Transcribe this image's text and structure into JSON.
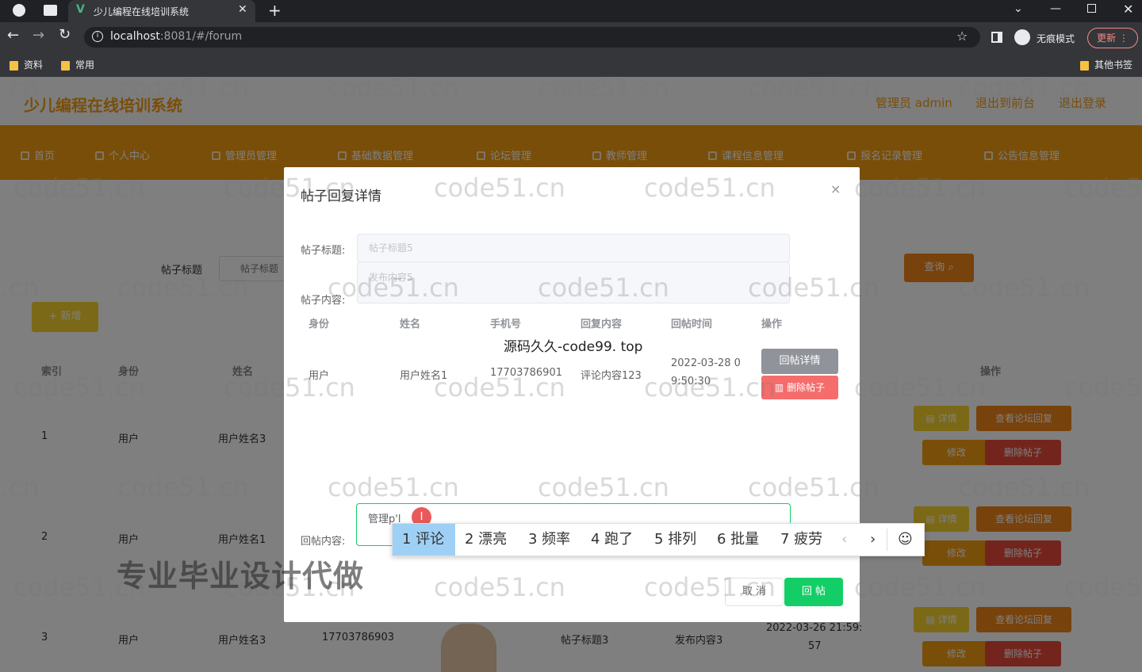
{
  "browser": {
    "tab_title": "少儿编程在线培训系统",
    "url_host": "localhost",
    "url_rest": ":8081/#/forum",
    "incognito_label": "无痕模式",
    "update_label": "更新",
    "bookmarks": [
      "资料",
      "常用"
    ],
    "other_bookmarks": "其他书签"
  },
  "header": {
    "site_title": "少儿编程在线培训系统",
    "admin_label": "管理员 admin",
    "to_front": "退出到前台",
    "logout": "退出登录"
  },
  "nav": [
    {
      "label": "首页"
    },
    {
      "label": "个人中心"
    },
    {
      "label": "管理员管理"
    },
    {
      "label": "基础数据管理"
    },
    {
      "label": "论坛管理"
    },
    {
      "label": "教师管理"
    },
    {
      "label": "课程信息管理"
    },
    {
      "label": "报名记录管理"
    },
    {
      "label": "公告信息管理"
    }
  ],
  "search": {
    "label": "帖子标题",
    "placeholder": "帖子标题",
    "query_button": "查询",
    "add_button": "+ 新增"
  },
  "table": {
    "headers": {
      "index": "索引",
      "role": "身份",
      "name": "姓名",
      "ops": "操作"
    },
    "rows": [
      {
        "index": "1",
        "role": "用户",
        "name": "用户姓名3"
      },
      {
        "index": "2",
        "role": "用户",
        "name": "用户姓名1"
      },
      {
        "index": "3",
        "role": "用户",
        "name": "用户姓名3",
        "phone": "17703786903",
        "title": "帖子标题3",
        "content": "发布内容3",
        "time": "2022-03-26 21:59:",
        "time2": "57"
      }
    ],
    "row_buttons": {
      "detail": "详情",
      "view_reply": "查看论坛回复",
      "edit": "修改",
      "delete": "删除帖子"
    }
  },
  "dialog": {
    "title": "帖子回复详情",
    "post_title_label": "帖子标题:",
    "post_title_value": "帖子标题5",
    "post_content_label": "帖子内容:",
    "post_content_value": "发布内容5",
    "columns": [
      "身份",
      "姓名",
      "手机号",
      "回复内容",
      "回帖时间",
      "操作"
    ],
    "reply_row": {
      "role": "用户",
      "name": "用户姓名1",
      "phone": "17703786901",
      "content": "评论内容123",
      "time_line1": "2022-03-28 0",
      "time_line2": "9:50:30",
      "detail_button": "回帖详情",
      "delete_button": "删除帖子"
    },
    "source_watermark": "源码久久-code99. top",
    "reply_label": "回帖内容:",
    "reply_value": "管理p'l",
    "cancel_button": "取 消",
    "submit_button": "回 帖"
  },
  "ime": {
    "candidates": [
      "1 评论",
      "2 漂亮",
      "3 频率",
      "4 跑了",
      "5 排列",
      "6 批量",
      "7 疲劳"
    ]
  },
  "watermarks": {
    "grid": "code51.cn",
    "promo": "专业毕业设计代做"
  },
  "colors": {
    "nav_orange": "#f39c12",
    "primary_green": "#13ce66",
    "danger_red": "#f56c6c",
    "info_gray": "#909399"
  }
}
